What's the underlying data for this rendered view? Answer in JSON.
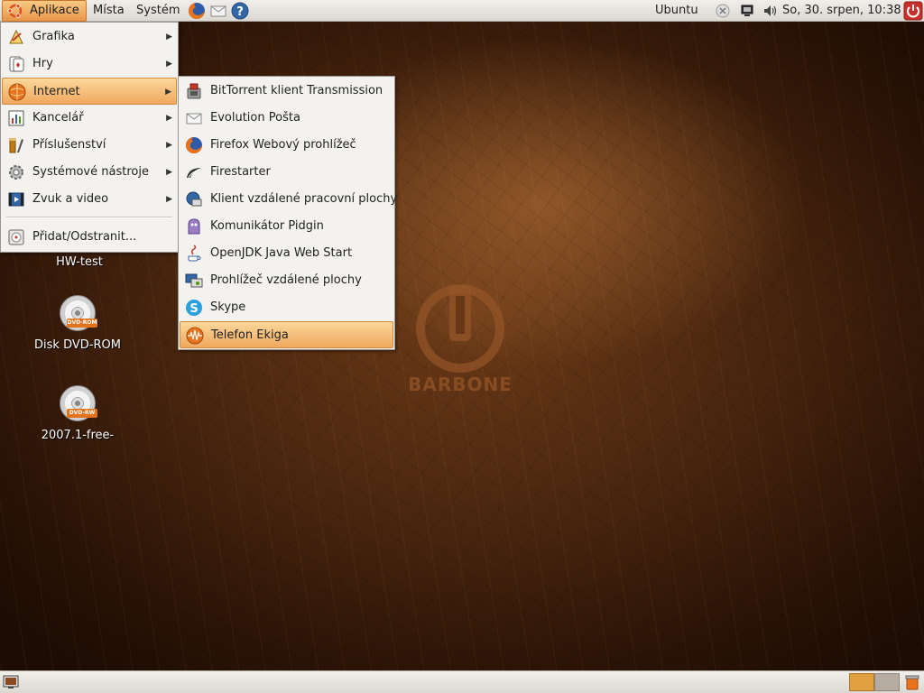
{
  "top_panel": {
    "menus": [
      "Aplikace",
      "Místa",
      "Systém"
    ],
    "user": "Ubuntu",
    "clock": "So, 30. srpen, 10:38"
  },
  "applications_menu": {
    "items": [
      {
        "label": "Grafika",
        "icon": "graphics-icon"
      },
      {
        "label": "Hry",
        "icon": "games-icon"
      },
      {
        "label": "Internet",
        "icon": "internet-icon"
      },
      {
        "label": "Kancelář",
        "icon": "office-icon"
      },
      {
        "label": "Příslušenství",
        "icon": "accessories-icon"
      },
      {
        "label": "Systémové nástroje",
        "icon": "system-tools-icon"
      },
      {
        "label": "Zvuk a video",
        "icon": "sound-video-icon"
      }
    ],
    "add_remove": "Přidat/Odstranit..."
  },
  "internet_submenu": {
    "items": [
      {
        "label": "BitTorrent klient Transmission",
        "icon": "transmission-icon"
      },
      {
        "label": "Evolution Pošta",
        "icon": "evolution-mail-icon"
      },
      {
        "label": "Firefox Webový prohlížeč",
        "icon": "firefox-icon"
      },
      {
        "label": "Firestarter",
        "icon": "firestarter-icon"
      },
      {
        "label": "Klient vzdálené pracovní plochy",
        "icon": "remote-desktop-client-icon"
      },
      {
        "label": "Komunikátor Pidgin",
        "icon": "pidgin-icon"
      },
      {
        "label": "OpenJDK Java  Web Start",
        "icon": "java-icon"
      },
      {
        "label": "Prohlížeč vzdálené plochy",
        "icon": "remote-desktop-viewer-icon"
      },
      {
        "label": "Skype",
        "icon": "skype-icon"
      },
      {
        "label": "Telefon Ekiga",
        "icon": "ekiga-icon"
      }
    ]
  },
  "desktop": {
    "icons": [
      {
        "label": "HW-test"
      },
      {
        "label": "Disk DVD-ROM",
        "badge": "DVD-ROM"
      },
      {
        "label": "2007.1-free-",
        "badge": "DVD-RW"
      }
    ],
    "wallpaper_logo": "BARBONE"
  },
  "colors": {
    "highlight": "#efa85e",
    "panel": "#e6e3de",
    "wallpaper": "#4a260f"
  }
}
